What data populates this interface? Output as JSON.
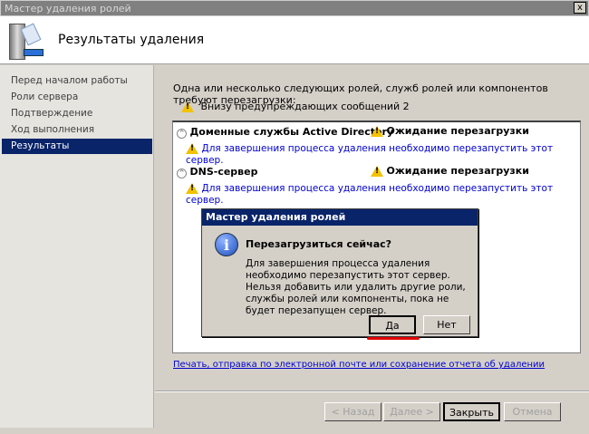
{
  "window": {
    "title": "Мастер удаления ролей",
    "close_label": "x"
  },
  "header": {
    "title": "Результаты удаления",
    "icon": "server-wizard-icon"
  },
  "sidebar": {
    "items": [
      {
        "label": "Перед началом работы",
        "selected": false
      },
      {
        "label": "Роли сервера",
        "selected": false
      },
      {
        "label": "Подтверждение",
        "selected": false
      },
      {
        "label": "Ход выполнения",
        "selected": false
      },
      {
        "label": "Результаты",
        "selected": true
      }
    ]
  },
  "main": {
    "intro": "Одна или несколько следующих ролей, служб ролей или компонентов требуют перезагрузки:",
    "warning_summary": "Внизу предупреждающих сообщений 2",
    "results": [
      {
        "role": "Доменные службы Active Directory",
        "status": "Ожидание перезагрузки",
        "message": "Для завершения процесса удаления необходимо перезапустить этот сервер."
      },
      {
        "role": "DNS-сервер",
        "status": "Ожидание перезагрузки",
        "message": "Для завершения процесса удаления необходимо перезапустить этот сервер."
      }
    ],
    "report_link": "Печать, отправка по электронной почте или сохранение отчета об удалении"
  },
  "dialog": {
    "title": "Мастер удаления ролей",
    "heading": "Перезагрузиться сейчас?",
    "body": "Для завершения процесса удаления необходимо перезапустить этот сервер. Нельзя добавить или удалить другие роли, службы ролей или компоненты, пока не будет перезапущен сервер.",
    "yes": "Да",
    "no": "Нет",
    "highlight_color": "#e00000"
  },
  "footer": {
    "back": "< Назад",
    "next": "Далее >",
    "close": "Закрыть",
    "cancel": "Отмена"
  }
}
